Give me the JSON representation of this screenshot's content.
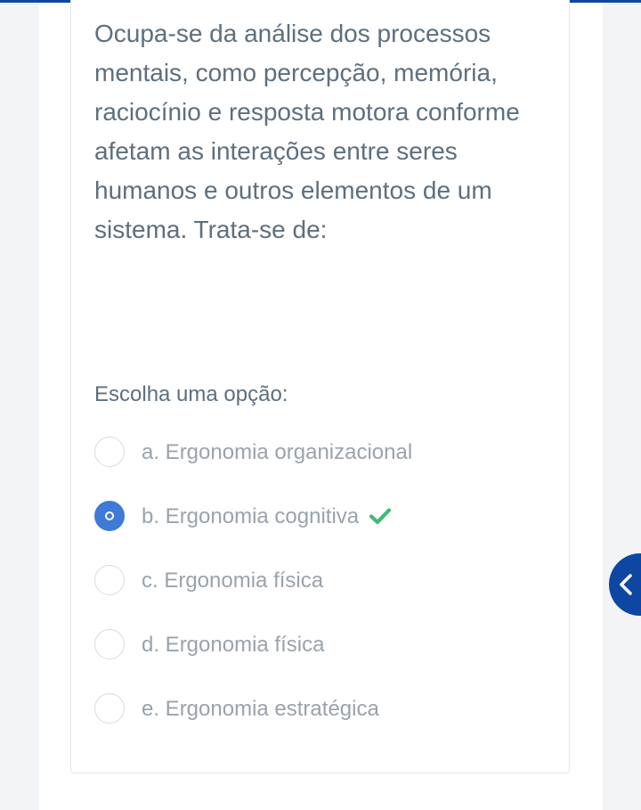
{
  "question": {
    "text": "Ocupa-se da análise dos processos mentais, como percepção, memória, raciocínio e resposta motora conforme afetam as interações entre seres humanos e outros elementos de um sistema. Trata-se de:",
    "prompt": "Escolha uma opção:"
  },
  "options": [
    {
      "label": "a. Ergonomia organizacional",
      "selected": false
    },
    {
      "label": "b. Ergonomia cognitiva",
      "selected": true,
      "correct": true
    },
    {
      "label": "c. Ergonomia física",
      "selected": false
    },
    {
      "label": "d. Ergonomia física",
      "selected": false
    },
    {
      "label": "e. Ergonomia estratégica",
      "selected": false
    }
  ],
  "icons": {
    "correct": "check-icon",
    "drawer": "chevron-left-icon"
  },
  "colors": {
    "accent": "#0d47a1",
    "radio_selected": "#3f7ad6",
    "correct": "#3dbb78",
    "text": "#5e6f7e",
    "option_text": "#9aa3ac"
  }
}
